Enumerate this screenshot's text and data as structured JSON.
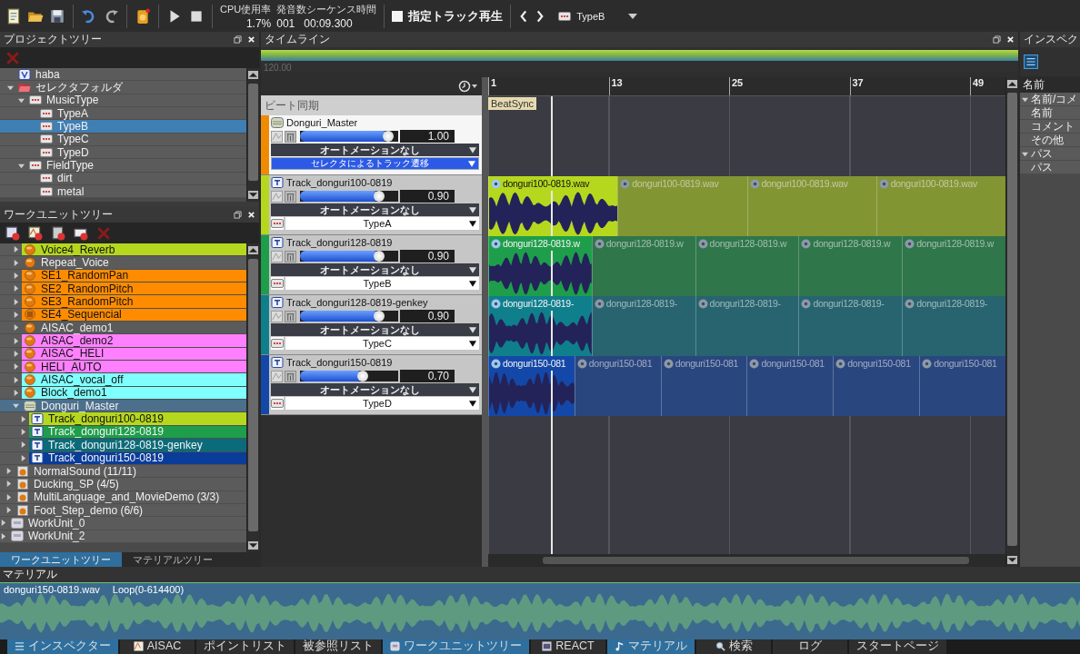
{
  "toolbar": {
    "cpu_label": "CPU使用率",
    "cpu_value": "1.7%",
    "stats_label": "発音数シーケンス時間",
    "voices": "001",
    "time": "00:09.300",
    "track_play": {
      "label": "指定トラック再生",
      "checked": false
    },
    "selector": "TypeB"
  },
  "project_tree": {
    "title": "プロジェクトツリー",
    "items": [
      {
        "label": "haba",
        "kind": "variable",
        "selected": false
      },
      {
        "label": "セレクタフォルダ",
        "kind": "folder",
        "expanded": true,
        "selected": false,
        "children": [
          {
            "label": "MusicType",
            "kind": "selector",
            "expanded": true,
            "selected": false,
            "children": [
              {
                "label": "TypeA",
                "kind": "selector_item",
                "selected": false
              },
              {
                "label": "TypeB",
                "kind": "selector_item",
                "selected": true
              },
              {
                "label": "TypeC",
                "kind": "selector_item",
                "selected": false
              },
              {
                "label": "TypeD",
                "kind": "selector_item",
                "selected": false
              }
            ]
          },
          {
            "label": "FieldType",
            "kind": "selector",
            "expanded": true,
            "selected": false,
            "children": [
              {
                "label": "dirt",
                "kind": "selector_item",
                "selected": false
              },
              {
                "label": "metal",
                "kind": "selector_item",
                "selected": false
              }
            ]
          }
        ]
      }
    ]
  },
  "work_unit_tree": {
    "title": "ワークユニットツリー",
    "items": [
      {
        "children": [
          {
            "children": [
              {
                "label": "Voice4_Reverb",
                "kind": "cue",
                "expanded": false,
                "selected": false,
                "color": "#b5d81e"
              },
              {
                "label": "Repeat_Voice",
                "kind": "cue",
                "expanded": false,
                "selected": false
              },
              {
                "label": "SE1_RandomPan",
                "kind": "cue",
                "expanded": false,
                "selected": false,
                "color": "#ff8c00"
              },
              {
                "label": "SE2_RandomPitch",
                "kind": "cue",
                "expanded": false,
                "selected": false,
                "color": "#ff8c00"
              },
              {
                "label": "SE3_RandomPitch",
                "kind": "cue",
                "expanded": false,
                "selected": false,
                "color": "#ff8c00"
              },
              {
                "label": "SE4_Sequencial",
                "kind": "sequence",
                "expanded": false,
                "selected": false,
                "color": "#ff8c00"
              },
              {
                "label": "AISAC_demo1",
                "kind": "cue",
                "expanded": false,
                "selected": false
              },
              {
                "label": "AISAC_demo2",
                "kind": "cue",
                "expanded": false,
                "selected": false,
                "color": "#ff80ff"
              },
              {
                "label": "AISAC_HELI",
                "kind": "cue",
                "expanded": false,
                "selected": false,
                "color": "#ff80ff"
              },
              {
                "label": "HELI_AUTO",
                "kind": "cue",
                "expanded": false,
                "selected": false,
                "color": "#ff80ff"
              },
              {
                "label": "AISAC_vocal_off",
                "kind": "cue",
                "expanded": false,
                "selected": false,
                "color": "#80ffff"
              },
              {
                "label": "Block_demo1",
                "kind": "cue",
                "expanded": false,
                "selected": false,
                "color": "#80ffff"
              },
              {
                "label": "Donguri_Master",
                "kind": "master",
                "expanded": true,
                "selected": true,
                "children": [
                  {
                    "label": "Track_donguri100-0819",
                    "kind": "track",
                    "expanded": false,
                    "selected": false,
                    "color": "#b5d81e"
                  },
                  {
                    "label": "Track_donguri128-0819",
                    "kind": "track",
                    "expanded": false,
                    "selected": false,
                    "color": "#1e9e4a"
                  },
                  {
                    "label": "Track_donguri128-0819-genkey",
                    "kind": "track",
                    "expanded": false,
                    "selected": false,
                    "color": "#0a6b7a"
                  },
                  {
                    "label": "Track_donguri150-0819",
                    "kind": "track",
                    "expanded": false,
                    "selected": false,
                    "color": "#0a3c9a"
                  }
                ]
              }
            ]
          },
          {
            "label": "NormalSound (11/11)",
            "kind": "cuesheet",
            "expanded": false,
            "selected": false
          },
          {
            "label": "Ducking_SP (4/5)",
            "kind": "cuesheet",
            "expanded": false,
            "selected": false
          },
          {
            "label": "MultiLanguage_and_MovieDemo (3/3)",
            "kind": "cuesheet",
            "expanded": false,
            "selected": false
          },
          {
            "label": "Foot_Step_demo (6/6)",
            "kind": "cuesheet",
            "expanded": false,
            "selected": false
          }
        ]
      },
      {
        "label": "WorkUnit_0",
        "kind": "workunit",
        "expanded": false,
        "selected": false
      },
      {
        "label": "WorkUnit_2",
        "kind": "workunit",
        "expanded": false,
        "selected": false
      }
    ],
    "tabs": [
      {
        "label": "ワークユニットツリー",
        "selected": true
      },
      {
        "label": "マテリアルツリー",
        "selected": false
      }
    ]
  },
  "timeline": {
    "title": "タイムライン",
    "tempo": "120.00",
    "ruler": [
      "1",
      "13",
      "25",
      "37",
      "49"
    ],
    "marker": "BeatSync",
    "beat_sync_label": "ビート同期",
    "tracks": [
      {
        "kind": "master",
        "name": "Donguri_Master",
        "color": "#f08a00",
        "level": 0.9,
        "value": "1.00",
        "automation": "オートメーションなし",
        "select": "セレクタによるトラック遷移"
      },
      {
        "kind": "track",
        "name": "Track_donguri100-0819",
        "color": "#b5d81e",
        "level": 0.81,
        "value": "0.90",
        "automation": "オートメーションなし",
        "select": "TypeA",
        "clips": [
          {
            "label": "donguri100-0819.wav",
            "active": true
          },
          {
            "label": "donguri100-0819.wav",
            "active": false
          },
          {
            "label": "donguri100-0819.wav",
            "active": false
          },
          {
            "label": "donguri100-0819.wav",
            "active": false
          }
        ]
      },
      {
        "kind": "track",
        "name": "Track_donguri128-0819",
        "color": "#1e9e4a",
        "level": 0.81,
        "value": "0.90",
        "automation": "オートメーションなし",
        "select": "TypeB",
        "clips": [
          {
            "label": "donguri128-0819.w",
            "active": true
          },
          {
            "label": "donguri128-0819.w",
            "active": false
          },
          {
            "label": "donguri128-0819.w",
            "active": false
          },
          {
            "label": "donguri128-0819.w",
            "active": false
          },
          {
            "label": "donguri128-0819.w",
            "active": false
          }
        ]
      },
      {
        "kind": "track",
        "name": "Track_donguri128-0819-genkey",
        "color": "#0f7f8c",
        "level": 0.81,
        "value": "0.90",
        "automation": "オートメーションなし",
        "select": "TypeC",
        "clips": [
          {
            "label": "donguri128-0819-",
            "active": true
          },
          {
            "label": "donguri128-0819-",
            "active": false
          },
          {
            "label": "donguri128-0819-",
            "active": false
          },
          {
            "label": "donguri128-0819-",
            "active": false
          },
          {
            "label": "donguri128-0819-",
            "active": false
          }
        ]
      },
      {
        "kind": "track",
        "name": "Track_donguri150-0819",
        "color": "#1448a8",
        "level": 0.64,
        "value": "0.70",
        "automation": "オートメーションなし",
        "select": "TypeD",
        "clips": [
          {
            "label": "donguri150-081",
            "active": true
          },
          {
            "label": "donguri150-081",
            "active": false
          },
          {
            "label": "donguri150-081",
            "active": false
          },
          {
            "label": "donguri150-081",
            "active": false
          },
          {
            "label": "donguri150-081",
            "active": false
          },
          {
            "label": "donguri150-081",
            "active": false
          }
        ]
      }
    ]
  },
  "inspector": {
    "title": "インスペク",
    "column": "名前",
    "items": [
      {
        "label": "名前/コメ",
        "expanded": true,
        "children": [
          {
            "label": "名前"
          },
          {
            "label": "コメント"
          }
        ]
      },
      {
        "label": "その他"
      },
      {
        "label": "パス",
        "expanded": true,
        "children": [
          {
            "label": "パス"
          }
        ]
      }
    ]
  },
  "material": {
    "title": "マテリアル",
    "file": "donguri150-0819.wav",
    "loop": "Loop(0-614400)"
  },
  "taskbar": [
    {
      "label": "インスペクター",
      "kind": "list",
      "selected": true
    },
    {
      "label": "AISAC",
      "kind": "aisac",
      "selected": false
    },
    {
      "label": "ポイントリスト",
      "selected": false
    },
    {
      "label": "被参照リスト",
      "selected": false
    },
    {
      "label": "ワークユニットツリー",
      "kind": "unit",
      "selected": true
    },
    {
      "label": "REACT",
      "kind": "react",
      "selected": false
    },
    {
      "label": "マテリアル",
      "kind": "note",
      "selected": true
    },
    {
      "label": "検索",
      "kind": "search",
      "selected": false
    },
    {
      "label": "ログ",
      "selected": false
    },
    {
      "label": "スタートページ",
      "selected": false
    }
  ]
}
